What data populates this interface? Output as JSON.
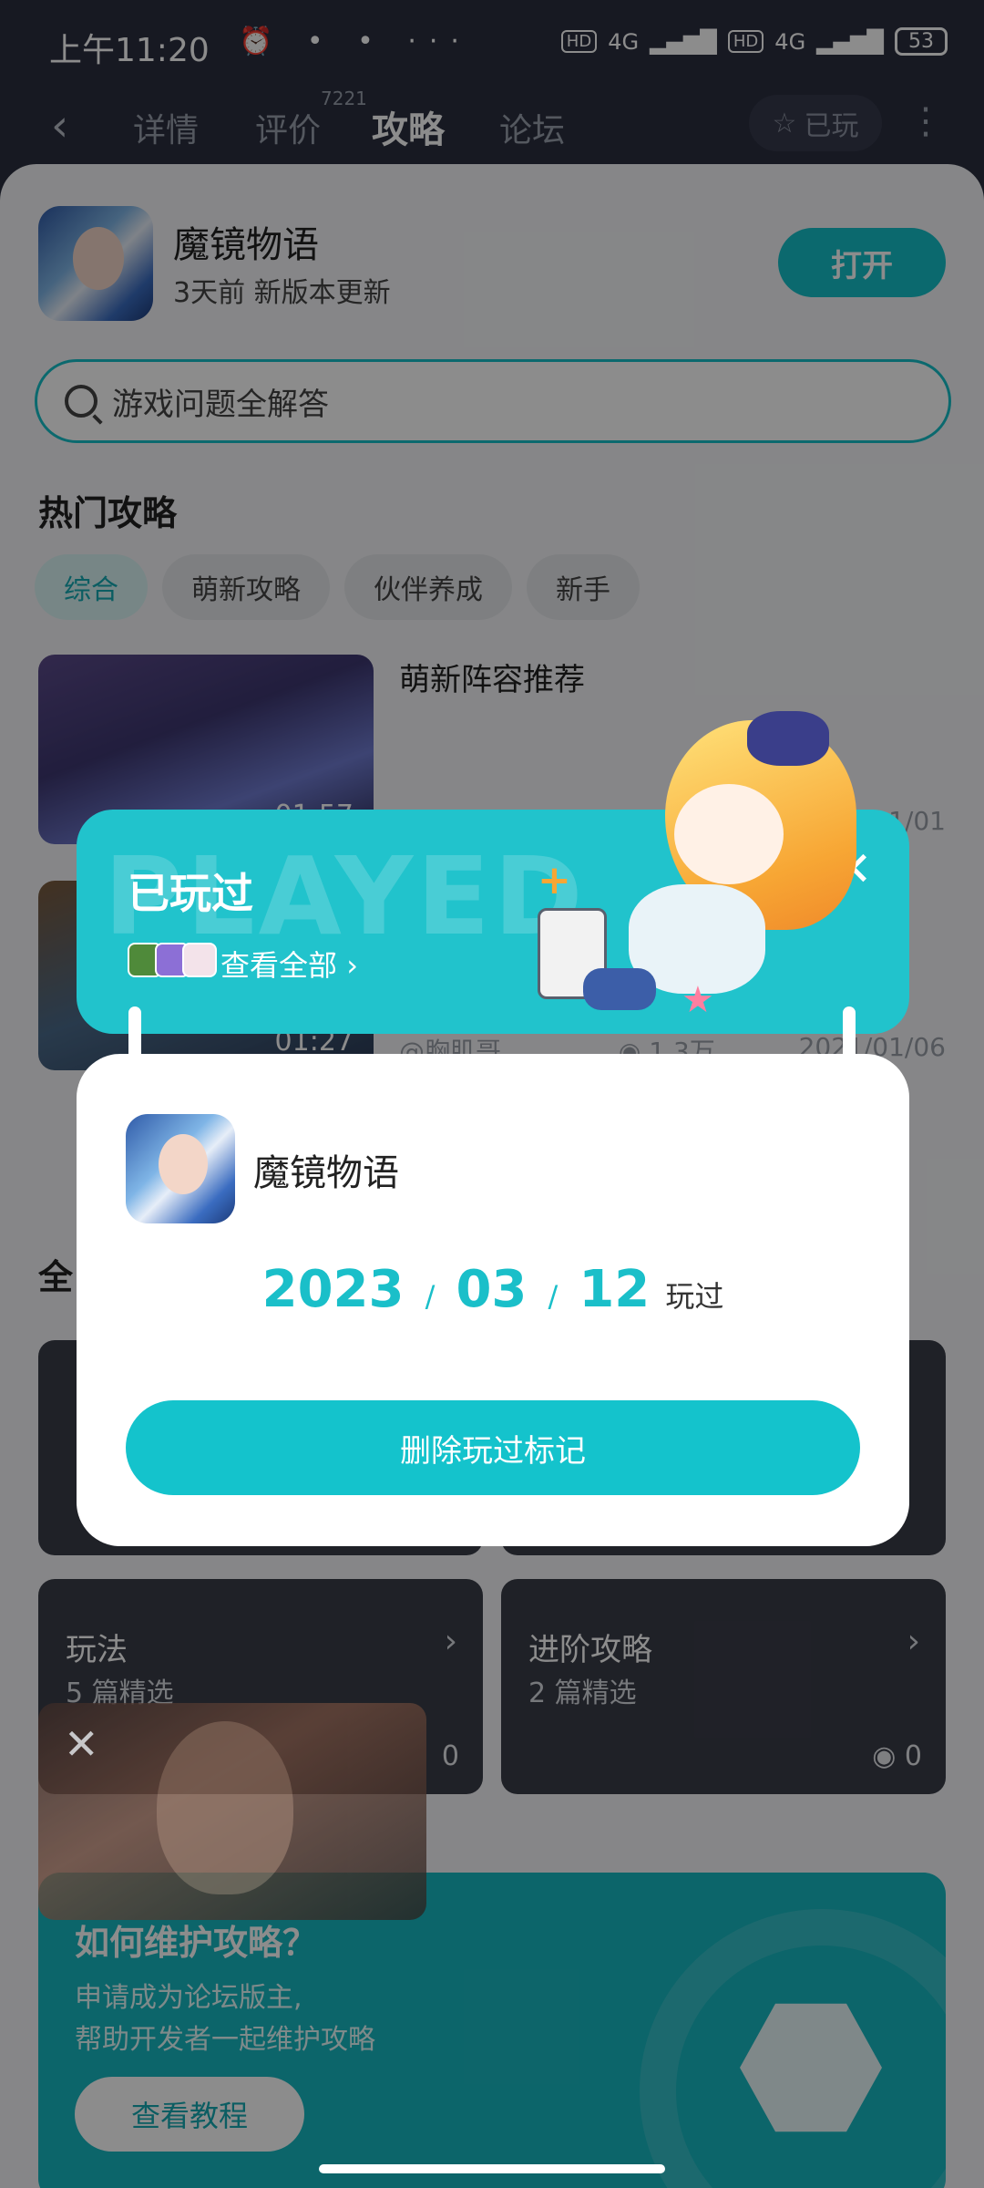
{
  "status_bar": {
    "time": "上午11:20",
    "icons": "⏰ • • ···",
    "hd1": "HD",
    "net1": "4G",
    "hd2": "HD",
    "net2": "4G",
    "battery": "53"
  },
  "nav": {
    "tabs": [
      "详情",
      "评价",
      "攻略",
      "论坛"
    ],
    "review_count": "7221",
    "active_tab": "攻略",
    "played_label": "已玩"
  },
  "game": {
    "name": "魔镜物语",
    "update_text": "3天前 新版本更新",
    "open_label": "打开"
  },
  "search": {
    "placeholder": "游戏问题全解答"
  },
  "hot_guides": {
    "title": "热门攻略",
    "chips": [
      "综合",
      "萌新攻略",
      "伙伴养成",
      "新手"
    ],
    "items": [
      {
        "title": "萌新阵容推荐",
        "duration": "01:57",
        "author": "",
        "views": "",
        "date": "2021/01/01"
      },
      {
        "title": "",
        "duration": "01:27",
        "author": "@胸肌哥",
        "views": "1.3万",
        "date": "2021/01/06"
      }
    ]
  },
  "all_guides": {
    "title": "全",
    "cards": [
      {
        "title": "玩法",
        "count": "5 篇精选",
        "views": "0"
      },
      {
        "title": "进阶攻略",
        "count": "2 篇精选",
        "views": "0"
      }
    ]
  },
  "promo": {
    "title": "如何维护攻略？",
    "line1": "申请成为论坛版主,",
    "line2": "帮助开发者一起维护攻略",
    "button": "查看教程"
  },
  "dialog": {
    "banner_bg_word": "PLAYED",
    "banner_title": "已玩过",
    "view_all": "查看全部",
    "game_name": "魔镜物语",
    "year": "2023",
    "month": "03",
    "day": "12",
    "played_suffix": "玩过",
    "delete_label": "删除玩过标记"
  },
  "colors": {
    "accent": "#15bfc8",
    "nav_bg": "#2b2e3f"
  }
}
